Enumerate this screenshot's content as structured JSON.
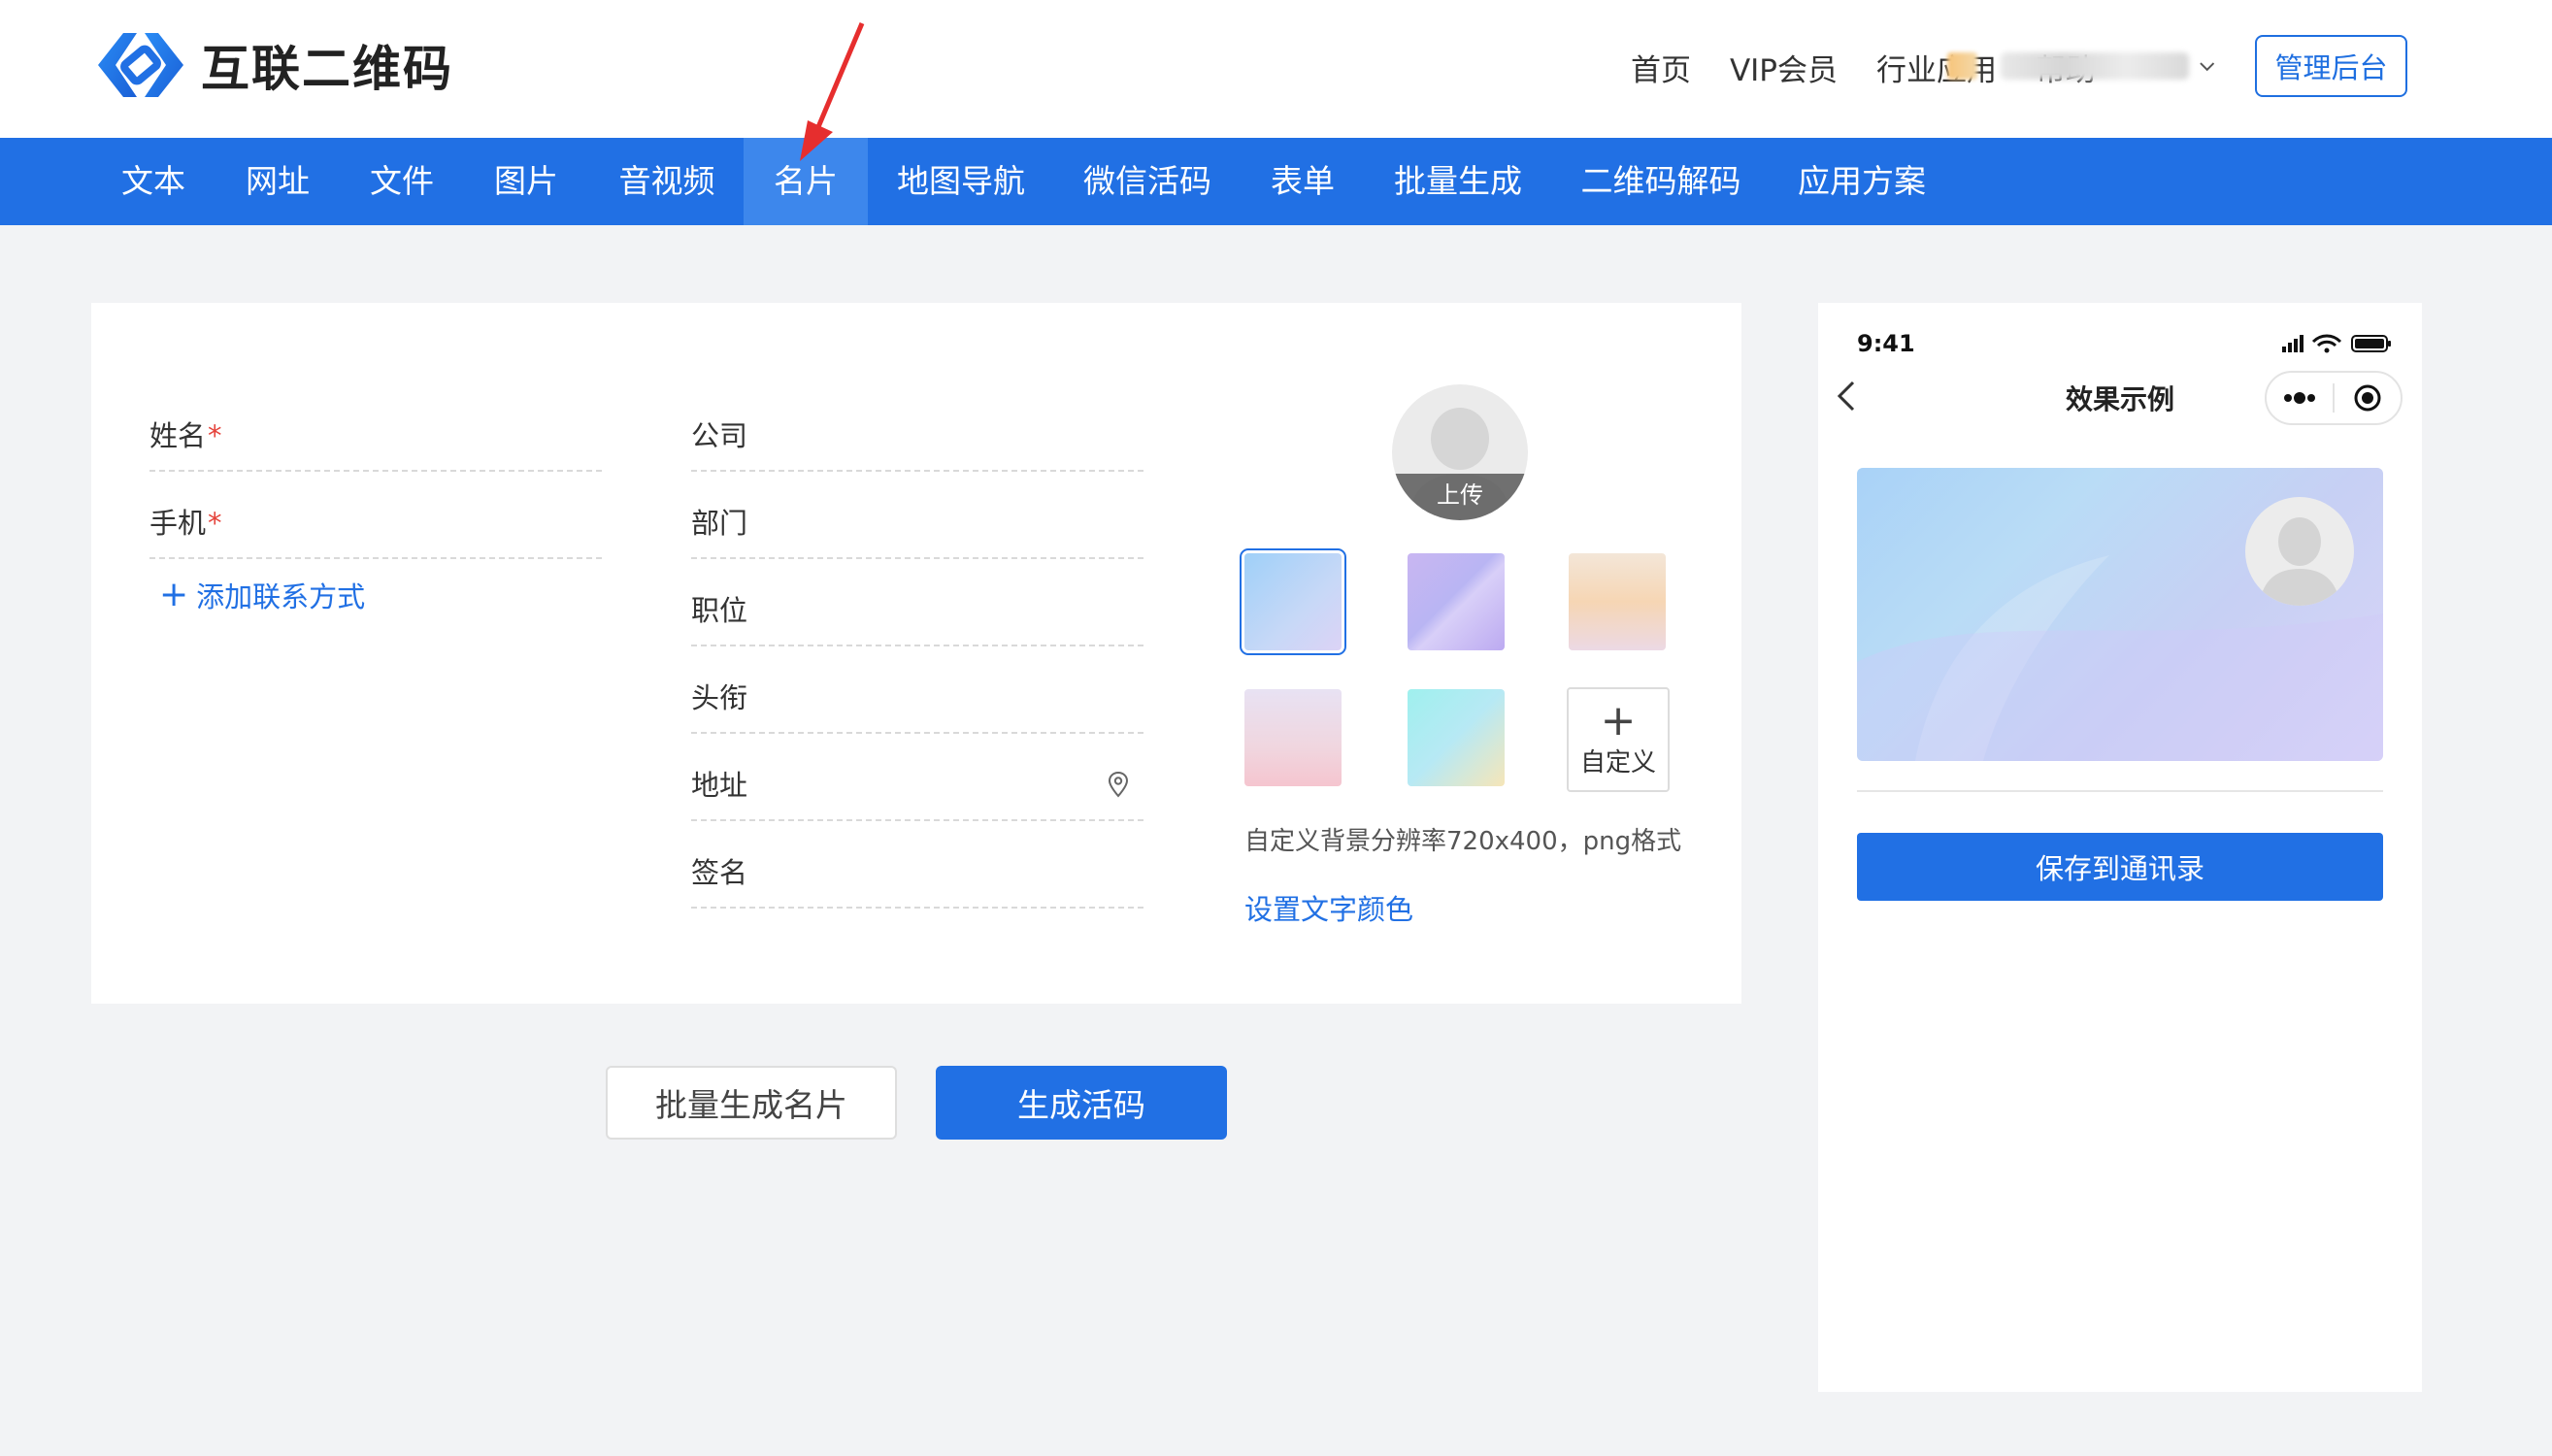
{
  "header": {
    "brand": "互联二维码",
    "nav": [
      "首页",
      "VIP会员",
      "行业应用",
      "帮助"
    ],
    "admin_label": "管理后台"
  },
  "main_nav": {
    "items": [
      "文本",
      "网址",
      "文件",
      "图片",
      "音视频",
      "名片",
      "地图导航",
      "微信活码",
      "表单",
      "批量生成",
      "二维码解码",
      "应用方案"
    ],
    "active": "名片"
  },
  "form": {
    "left": {
      "name_label": "姓名",
      "phone_label": "手机",
      "required_mark": "*",
      "add_contact": "添加联系方式"
    },
    "right": {
      "company_label": "公司",
      "department_label": "部门",
      "position_label": "职位",
      "title_label": "头衔",
      "address_label": "地址",
      "signature_label": "签名"
    },
    "upload_label": "上传",
    "custom_bg_label": "自定义",
    "bg_hint": "自定义背景分辨率720x400，png格式",
    "text_color_link": "设置文字颜色"
  },
  "actions": {
    "batch_label": "批量生成名片",
    "generate_label": "生成活码"
  },
  "preview": {
    "time": "9:41",
    "title": "效果示例",
    "save_label": "保存到通讯录"
  },
  "colors": {
    "primary": "#2170e4",
    "active_tab": "#3d87ec",
    "required": "#e5433b"
  }
}
